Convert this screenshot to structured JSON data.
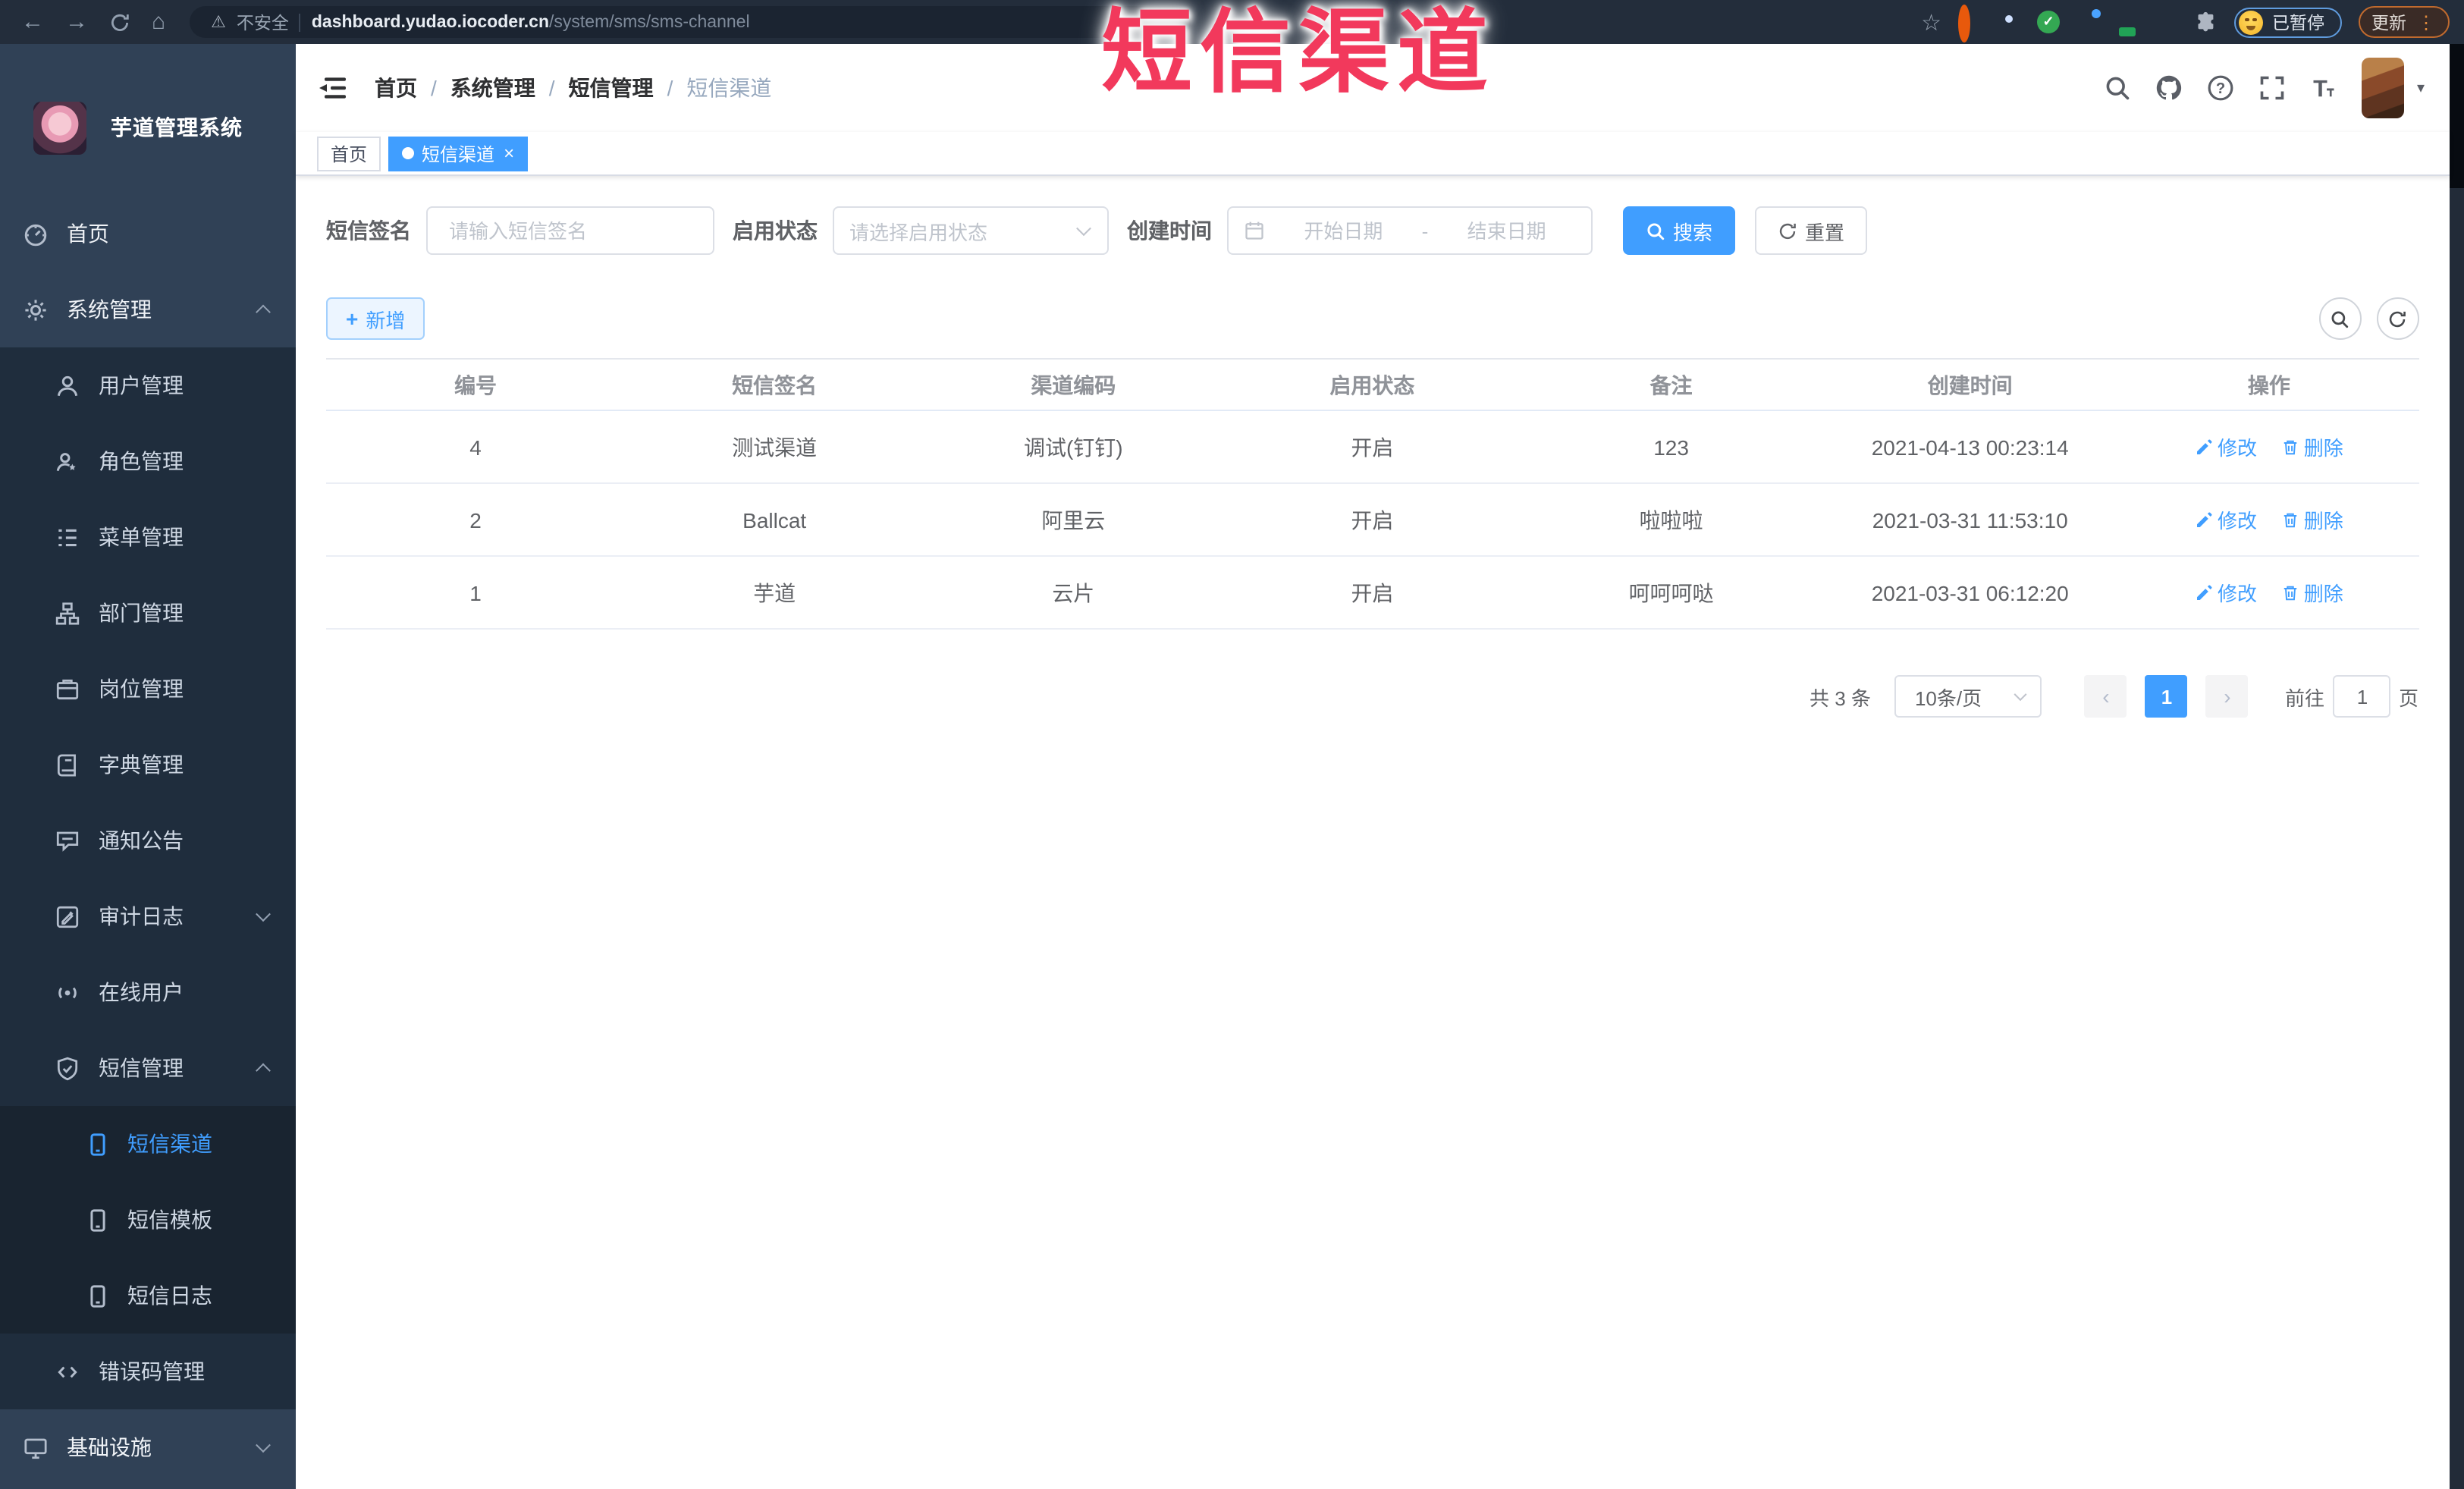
{
  "browser": {
    "security": "不安全",
    "url_host": "dashboard.yudao.iocoder.cn",
    "url_path": "/system/sms/sms-channel",
    "paused_label": "已暂停",
    "update_label": "更新"
  },
  "annotation": {
    "text": "短信渠道"
  },
  "sidebar": {
    "app_title": "芋道管理系统",
    "home": "首页",
    "system_mgmt": "系统管理",
    "sub": [
      "用户管理",
      "角色管理",
      "菜单管理",
      "部门管理",
      "岗位管理",
      "字典管理",
      "通知公告",
      "审计日志",
      "在线用户",
      "短信管理"
    ],
    "sms_children": [
      "短信渠道",
      "短信模板",
      "短信日志"
    ],
    "error_code": "错误码管理",
    "infra": "基础设施"
  },
  "breadcrumb": [
    "首页",
    "系统管理",
    "短信管理",
    "短信渠道"
  ],
  "breadcrumb_sep": "/",
  "tabs": {
    "home": "首页",
    "active": "短信渠道",
    "close": "×"
  },
  "filters": {
    "sign_label": "短信签名",
    "sign_placeholder": "请输入短信签名",
    "status_label": "启用状态",
    "status_placeholder": "请选择启用状态",
    "time_label": "创建时间",
    "start_placeholder": "开始日期",
    "range_separator": "-",
    "end_placeholder": "结束日期",
    "search_label": "搜索",
    "reset_label": "重置"
  },
  "toolbar": {
    "add_label": "新增"
  },
  "table": {
    "headers": [
      "编号",
      "短信签名",
      "渠道编码",
      "启用状态",
      "备注",
      "创建时间",
      "操作"
    ],
    "rows": [
      {
        "id": "4",
        "sign": "测试渠道",
        "code": "调试(钉钉)",
        "status": "开启",
        "remark": "123",
        "created": "2021-04-13 00:23:14"
      },
      {
        "id": "2",
        "sign": "Ballcat",
        "code": "阿里云",
        "status": "开启",
        "remark": "啦啦啦",
        "created": "2021-03-31 11:53:10"
      },
      {
        "id": "1",
        "sign": "芋道",
        "code": "云片",
        "status": "开启",
        "remark": "呵呵呵哒",
        "created": "2021-03-31 06:12:20"
      }
    ],
    "edit_label": "修改",
    "delete_label": "删除"
  },
  "pagination": {
    "total": "共 3 条",
    "page_size": "10条/页",
    "current_page": "1",
    "goto_label": "前往",
    "goto_value": "1",
    "page_unit": "页"
  },
  "colors": {
    "accent": "#409eff",
    "annotation": "#f2395c",
    "sidebar_bg": "#304156"
  }
}
